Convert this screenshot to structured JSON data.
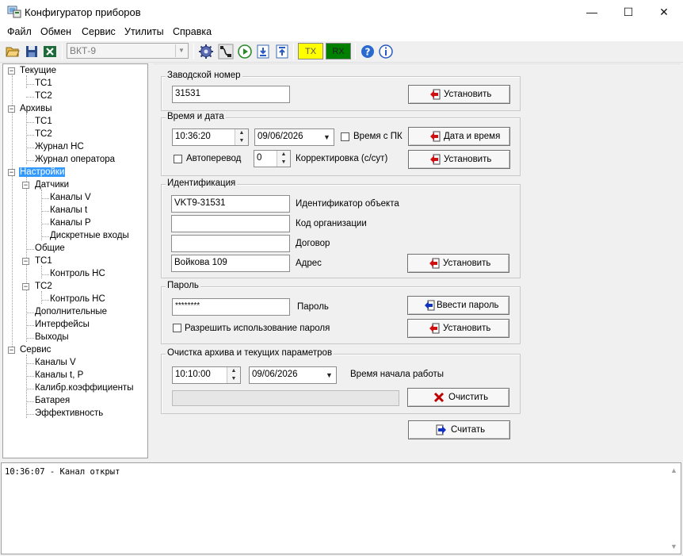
{
  "window": {
    "title": "Конфигуратор приборов",
    "controls": {
      "minimize": "—",
      "maximize": "☐",
      "close": "✕"
    }
  },
  "menu": [
    "Файл",
    "Обмен",
    "Сервис",
    "Утилиты",
    "Справка"
  ],
  "toolbar": {
    "device": "ВКТ-9",
    "tx": "TX",
    "rx": "RX",
    "colors": {
      "tx": "#ffff00",
      "rx": "#008000"
    }
  },
  "tree": {
    "nodes": [
      {
        "label": "Текущие"
      },
      {
        "label": "ТС1"
      },
      {
        "label": "ТС2"
      },
      {
        "label": "Архивы"
      },
      {
        "label": "ТС1"
      },
      {
        "label": "ТС2"
      },
      {
        "label": "Журнал НС"
      },
      {
        "label": "Журнал оператора"
      },
      {
        "label": "Настройки",
        "selected": true
      },
      {
        "label": "Датчики"
      },
      {
        "label": "Каналы V"
      },
      {
        "label": "Каналы t"
      },
      {
        "label": "Каналы P"
      },
      {
        "label": "Дискретные входы"
      },
      {
        "label": "Общие"
      },
      {
        "label": "ТС1"
      },
      {
        "label": "Контроль НС"
      },
      {
        "label": "ТС2"
      },
      {
        "label": "Контроль НС"
      },
      {
        "label": "Дополнительные"
      },
      {
        "label": "Интерфейсы"
      },
      {
        "label": "Выходы"
      },
      {
        "label": "Сервис"
      },
      {
        "label": "Каналы V"
      },
      {
        "label": "Каналы t, P"
      },
      {
        "label": "Калибр.коэффициенты"
      },
      {
        "label": "Батарея"
      },
      {
        "label": "Эффективность"
      }
    ]
  },
  "serial": {
    "title": "Заводской номер",
    "value": "31531",
    "set_button": "Установить"
  },
  "datetime": {
    "title": "Время и дата",
    "time": "10:36:20",
    "date": "09/06/2026",
    "pc_time_label": "Время с ПК",
    "pc_time_checked": false,
    "datetime_button": "Дата и время",
    "autotransfer_label": "Автоперевод",
    "autotransfer_checked": false,
    "correction_value": "0",
    "correction_label": "Корректировка (с/сут)",
    "set_button": "Установить"
  },
  "identification": {
    "title": "Идентификация",
    "object_id": "VKT9-31531",
    "object_id_label": "Идентификатор объекта",
    "org_code": "",
    "org_code_label": "Код организации",
    "contract": "",
    "contract_label": "Договор",
    "address": "Войкова 109",
    "address_label": "Адрес",
    "set_button": "Установить"
  },
  "password": {
    "title": "Пароль",
    "value": "********",
    "label": "Пароль",
    "enter_button": "Ввести пароль",
    "allow_label": "Разрешить использование пароля",
    "allow_checked": false,
    "set_button": "Установить"
  },
  "clear": {
    "title": "Очистка архива и текущих параметров",
    "time": "10:10:00",
    "date": "09/06/2026",
    "start_label": "Время начала работы",
    "progress": 0,
    "clear_button": "Очистить"
  },
  "read_button": "Считать",
  "log": {
    "lines": [
      "10:36:07 - Канал открыт"
    ]
  }
}
